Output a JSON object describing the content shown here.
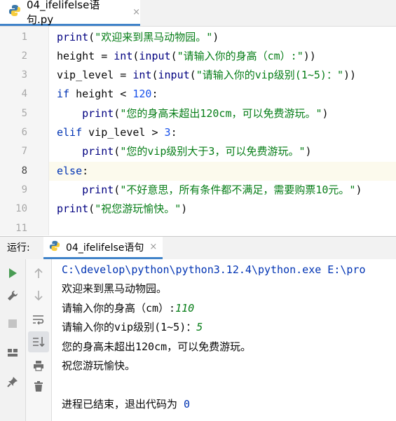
{
  "editor_tab": {
    "filename": "04_ifelifelse语句.py",
    "close_glyph": "×"
  },
  "code": {
    "line_numbers": [
      "1",
      "2",
      "3",
      "4",
      "5",
      "6",
      "7",
      "8",
      "9",
      "10",
      "11"
    ],
    "line1": {
      "fn": "print",
      "open": "(",
      "str": "\"欢迎来到黑马动物园。\"",
      "close": ")"
    },
    "line2": {
      "var": "height = ",
      "b1": "int",
      "p1": "(",
      "b2": "input",
      "p2": "(",
      "str": "\"请输入你的身高（cm）:\"",
      "close": "))"
    },
    "line3": {
      "var": "vip_level = ",
      "b1": "int",
      "p1": "(",
      "b2": "input",
      "p2": "(",
      "str": "\"请输入你的vip级别(1~5)：\"",
      "close": "))"
    },
    "line4": {
      "kw": "if",
      "mid": " height < ",
      "num": "120",
      "end": ":"
    },
    "line5": {
      "indent": "    ",
      "fn": "print",
      "open": "(",
      "str": "\"您的身高未超出120cm，可以免费游玩。\"",
      "close": ")"
    },
    "line6": {
      "kw": "elif",
      "mid": " vip_level > ",
      "num": "3",
      "end": ":"
    },
    "line7": {
      "indent": "    ",
      "fn": "print",
      "open": "(",
      "str": "\"您的vip级别大于3，可以免费游玩。\"",
      "close": ")"
    },
    "line8": {
      "kw": "else",
      "end": ":"
    },
    "line9": {
      "indent": "    ",
      "fn": "print",
      "open": "(",
      "str": "\"不好意思，所有条件都不满足，需要购票10元。\"",
      "close": ")"
    },
    "line10": {
      "fn": "print",
      "open": "(",
      "str": "\"祝您游玩愉快。\"",
      "close": ")"
    }
  },
  "run_panel": {
    "label": "运行:",
    "tab_name": "04_ifelifelse语句",
    "close_glyph": "×"
  },
  "console": {
    "command": "C:\\develop\\python\\python3.12.4\\python.exe E:\\pro",
    "out1": "欢迎来到黑马动物园。",
    "prompt_height": "请输入你的身高（cm）:",
    "input_height": "110",
    "prompt_vip": "请输入你的vip级别(1~5)：",
    "input_vip": "5",
    "out2": "您的身高未超出120cm，可以免费游玩。",
    "out3": "祝您游玩愉快。",
    "exit_text": "进程已结束，退出代码为 ",
    "exit_code": "0"
  },
  "colors": {
    "accent": "#4083c9",
    "keyword": "#0033b3",
    "string": "#067d17",
    "number": "#1750eb",
    "run_green": "#499c54"
  }
}
